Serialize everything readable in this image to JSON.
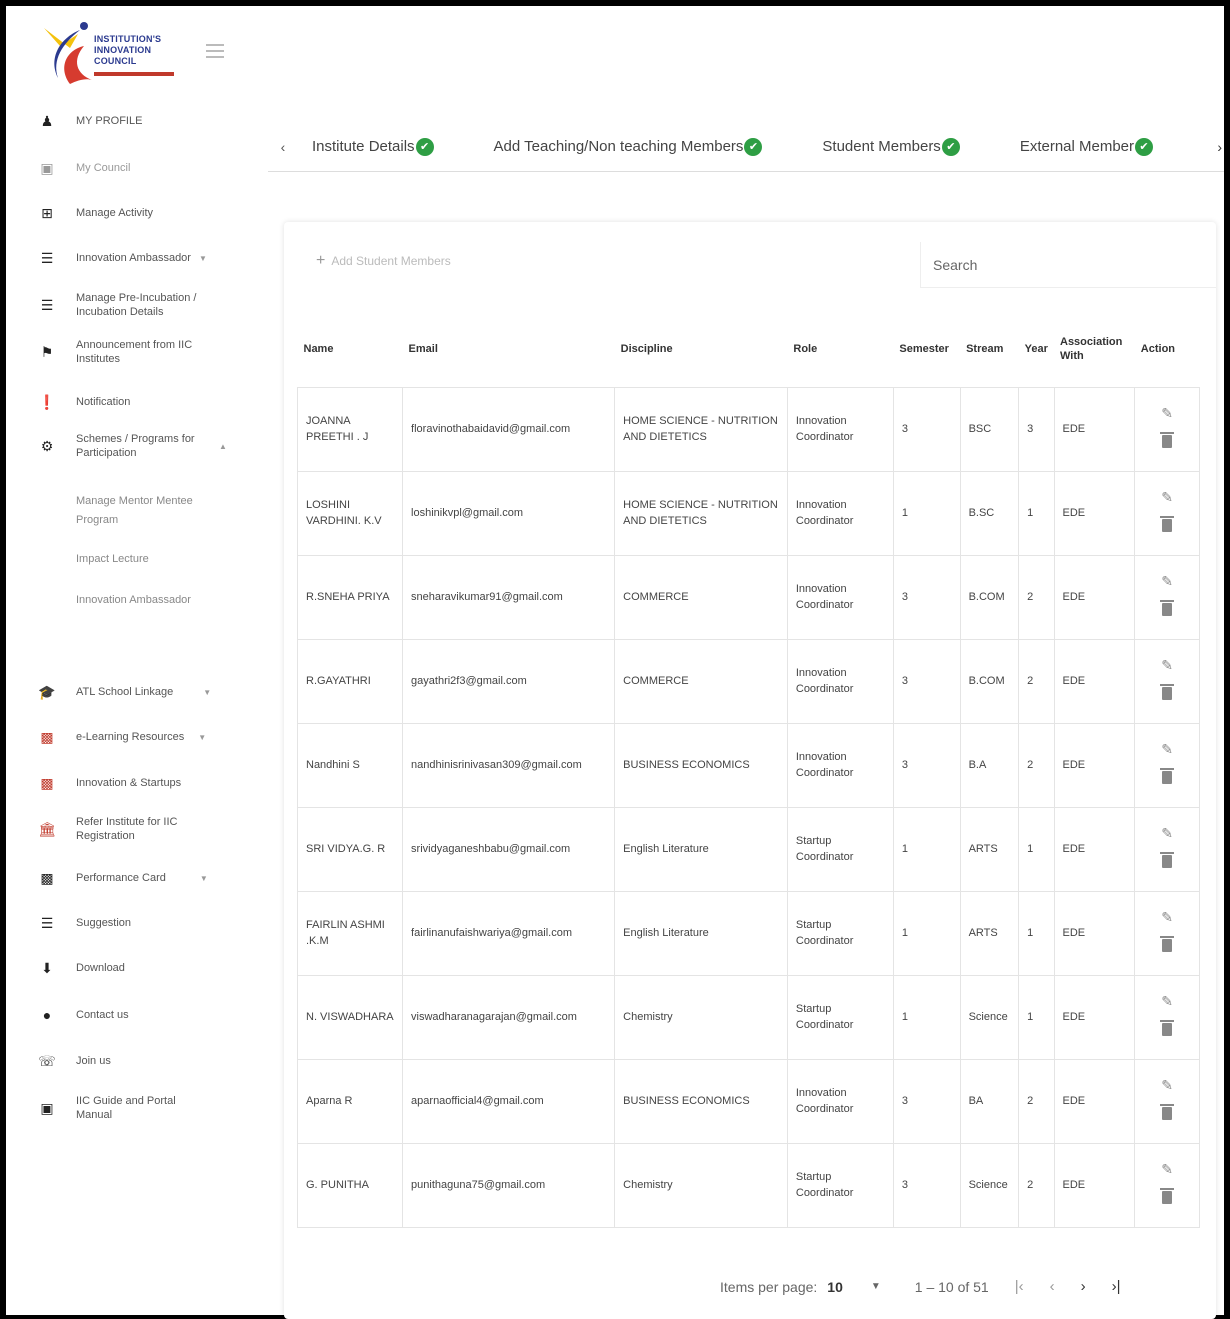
{
  "logo": {
    "line1": "INSTITUTION'S",
    "line2": "INNOVATION",
    "line3": "COUNCIL"
  },
  "sidebar": {
    "items": [
      {
        "label": "MY PROFILE",
        "icon": "user-icon"
      },
      {
        "label": "My Council",
        "icon": "edit-square-icon"
      },
      {
        "label": "Manage Activity",
        "icon": "table-icon"
      },
      {
        "label": "Innovation Ambassador",
        "icon": "list-icon"
      },
      {
        "label": "Manage Pre-Incubation / Incubation Details",
        "icon": "layers-icon"
      },
      {
        "label": "Announcement from IIC Institutes",
        "icon": "megaphone-icon"
      },
      {
        "label": "Notification",
        "icon": "alert-icon"
      },
      {
        "label": "Schemes / Programs for Participation",
        "icon": "gears-icon"
      },
      {
        "label": "ATL School Linkage",
        "icon": "graduation-cap-icon"
      },
      {
        "label": "e-Learning Resources",
        "icon": "presentation-icon"
      },
      {
        "label": "Innovation & Startups",
        "icon": "presentation-icon"
      },
      {
        "label": "Refer Institute for IIC Registration",
        "icon": "institution-icon"
      },
      {
        "label": "Performance Card",
        "icon": "bar-chart-icon"
      },
      {
        "label": "Suggestion",
        "icon": "menu-icon"
      },
      {
        "label": "Download",
        "icon": "download-icon"
      },
      {
        "label": "Contact us",
        "icon": "location-pin-icon"
      },
      {
        "label": "Join us",
        "icon": "whatsapp-icon"
      },
      {
        "label": "IIC Guide and Portal Manual",
        "icon": "book-icon"
      }
    ],
    "subitems": [
      "Manage Mentor Mentee Program",
      "Impact Lecture",
      "Innovation Ambassador"
    ]
  },
  "tabs": [
    {
      "label": "Institute Details"
    },
    {
      "label": "Add Teaching/Non teaching Members"
    },
    {
      "label": "Student Members"
    },
    {
      "label": "External Member"
    }
  ],
  "toolbar": {
    "add_label": "Add Student Members",
    "search_placeholder": "Search"
  },
  "table": {
    "headers": {
      "name": "Name",
      "email": "Email",
      "discipline": "Discipline",
      "role": "Role",
      "semester": "Semester",
      "stream": "Stream",
      "year": "Year",
      "association": "Association With",
      "action": "Action"
    },
    "rows": [
      {
        "name": "JOANNA PREETHI . J",
        "email": "floravinothabaidavid@gmail.com",
        "discipline": "HOME SCIENCE - NUTRITION AND DIETETICS",
        "role": "Innovation Coordinator",
        "semester": "3",
        "stream": "BSC",
        "year": "3",
        "association": "EDE"
      },
      {
        "name": "LOSHINI VARDHINI. K.V",
        "email": "loshinikvpl@gmail.com",
        "discipline": "HOME SCIENCE - NUTRITION AND DIETETICS",
        "role": "Innovation Coordinator",
        "semester": "1",
        "stream": "B.SC",
        "year": "1",
        "association": "EDE"
      },
      {
        "name": "R.SNEHA PRIYA",
        "email": "sneharavikumar91@gmail.com",
        "discipline": "COMMERCE",
        "role": "Innovation Coordinator",
        "semester": "3",
        "stream": "B.COM",
        "year": "2",
        "association": "EDE"
      },
      {
        "name": "R.GAYATHRI",
        "email": "gayathri2f3@gmail.com",
        "discipline": "COMMERCE",
        "role": "Innovation Coordinator",
        "semester": "3",
        "stream": "B.COM",
        "year": "2",
        "association": "EDE"
      },
      {
        "name": "Nandhini S",
        "email": "nandhinisrinivasan309@gmail.com",
        "discipline": "BUSINESS ECONOMICS",
        "role": "Innovation Coordinator",
        "semester": "3",
        "stream": "B.A",
        "year": "2",
        "association": "EDE"
      },
      {
        "name": "SRI VIDYA.G. R",
        "email": "srividyaganeshbabu@gmail.com",
        "discipline": "English Literature",
        "role": "Startup Coordinator",
        "semester": "1",
        "stream": "ARTS",
        "year": "1",
        "association": "EDE"
      },
      {
        "name": "FAIRLIN ASHMI .K.M",
        "email": "fairlinanufaishwariya@gmail.com",
        "discipline": "English Literature",
        "role": "Startup Coordinator",
        "semester": "1",
        "stream": "ARTS",
        "year": "1",
        "association": "EDE"
      },
      {
        "name": "N. VISWADHARA",
        "email": "viswadharanagarajan@gmail.com",
        "discipline": "Chemistry",
        "role": "Startup Coordinator",
        "semester": "1",
        "stream": "Science",
        "year": "1",
        "association": "EDE"
      },
      {
        "name": "Aparna R",
        "email": "aparnaofficial4@gmail.com",
        "discipline": "BUSINESS ECONOMICS",
        "role": "Innovation Coordinator",
        "semester": "3",
        "stream": "BA",
        "year": "2",
        "association": "EDE"
      },
      {
        "name": "G. PUNITHA",
        "email": "punithaguna75@gmail.com",
        "discipline": "Chemistry",
        "role": "Startup Coordinator",
        "semester": "3",
        "stream": "Science",
        "year": "2",
        "association": "EDE"
      }
    ]
  },
  "paginator": {
    "label": "Items per page:",
    "size": "10",
    "range": "1 – 10 of 51"
  },
  "colors": {
    "check_green": "#2e9e44",
    "logo_blue": "#2b3a8f",
    "logo_red": "#c0392b"
  }
}
